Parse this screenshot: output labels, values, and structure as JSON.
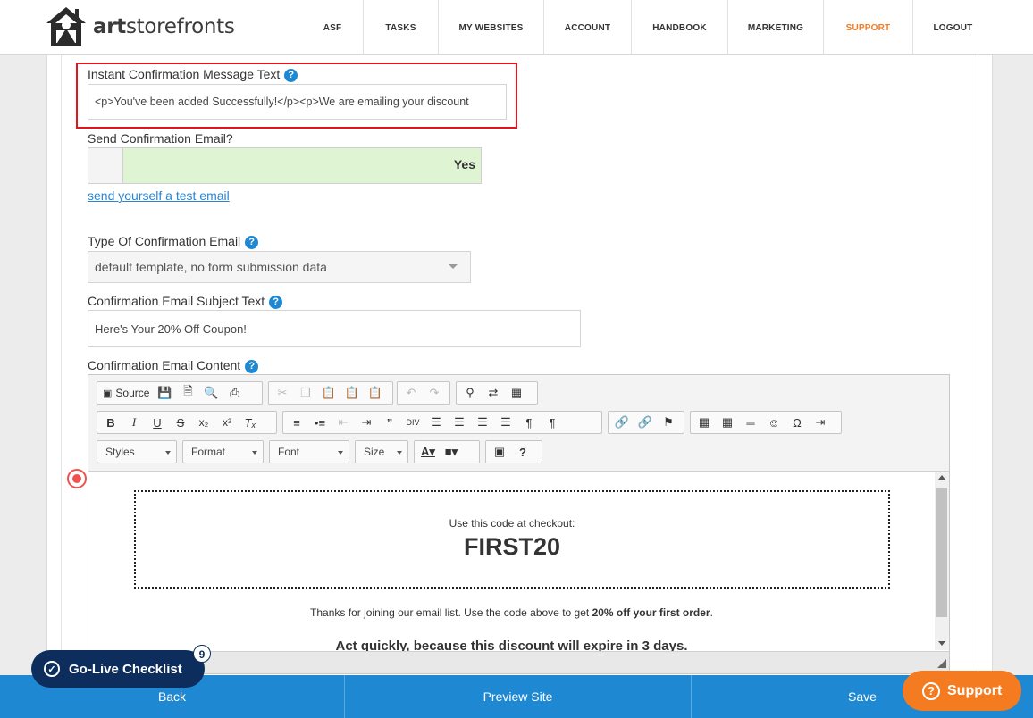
{
  "brand": {
    "name_light": "art",
    "name_rest": "storefronts"
  },
  "nav": [
    {
      "label": "ASF"
    },
    {
      "label": "TASKS"
    },
    {
      "label": "MY WEBSITES"
    },
    {
      "label": "ACCOUNT"
    },
    {
      "label": "HANDBOOK"
    },
    {
      "label": "MARKETING"
    },
    {
      "label": "SUPPORT",
      "active": true
    },
    {
      "label": "LOGOUT"
    }
  ],
  "form": {
    "instant_label": "Instant Confirmation Message Text",
    "instant_value": "<p>You've been added Successfully!</p><p>We are emailing your discount",
    "send_email_label": "Send Confirmation Email?",
    "send_email_toggle": "Yes",
    "test_email_link": "send yourself a test email",
    "type_label": "Type Of Confirmation Email",
    "type_value": "default template, no form submission data",
    "subject_label": "Confirmation Email Subject Text",
    "subject_value": "Here's Your 20% Off Coupon!",
    "content_label": "Confirmation Email Content"
  },
  "editor": {
    "source_label": "Source",
    "combos": {
      "styles": "Styles",
      "format": "Format",
      "font": "Font",
      "size": "Size"
    },
    "content": {
      "coupon_prompt": "Use this code at checkout:",
      "coupon_code": "FIRST20",
      "thanks_text": "Thanks for joining our email list.  Use the code above to get ",
      "thanks_bold": "20% off your first order",
      "thanks_end": ".",
      "act_text": "Act quickly, because this discount will expire in 3 days."
    }
  },
  "footer": {
    "back": "Back",
    "preview": "Preview Site",
    "save": "Save"
  },
  "checklist": {
    "label": "Go-Live Checklist",
    "count": "9"
  },
  "support_button": {
    "label": "Support"
  },
  "help_glyph": "?",
  "colors": {
    "accent": "#f47b20",
    "footer": "#1e88d2",
    "highlight_border": "#e3141b",
    "toggle_on": "#dff4d2",
    "checklist_bg": "#0d2e5c"
  }
}
